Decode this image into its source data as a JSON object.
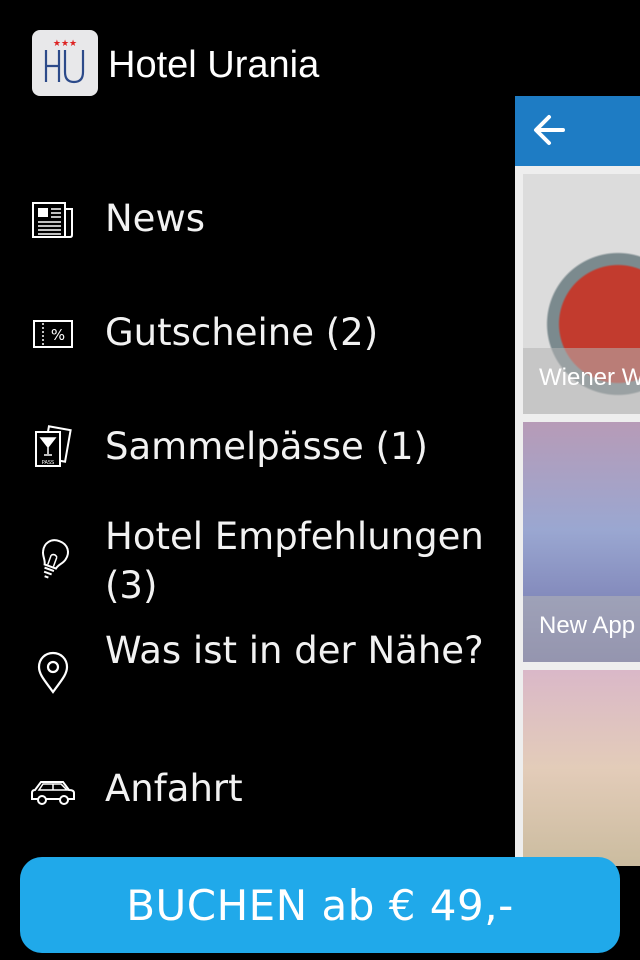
{
  "app": {
    "title": "Hotel Urania",
    "logo_text": "HU",
    "accent_color": "#20a9ea",
    "header_color": "#1e7cc4"
  },
  "menu": {
    "items": [
      {
        "id": "news",
        "label": "News",
        "icon": "newspaper-icon"
      },
      {
        "id": "gutscheine",
        "label": "Gutscheine (2)",
        "icon": "coupon-icon"
      },
      {
        "id": "sammelpaesse",
        "label": "Sammelpässe (1)",
        "icon": "stamp-pass-icon"
      },
      {
        "id": "empfehlungen",
        "label": "Hotel Empfehlungen (3)",
        "icon": "lightbulb-icon"
      },
      {
        "id": "naehe",
        "label": "Was ist in der Nähe?",
        "icon": "map-pin-icon"
      },
      {
        "id": "anfahrt",
        "label": "Anfahrt",
        "icon": "car-icon"
      }
    ]
  },
  "content_peek": {
    "cards": [
      {
        "caption": "Wiener W"
      },
      {
        "caption": "New App"
      },
      {
        "caption": ""
      }
    ]
  },
  "booking": {
    "button_label": "BUCHEN ab € 49,-"
  }
}
